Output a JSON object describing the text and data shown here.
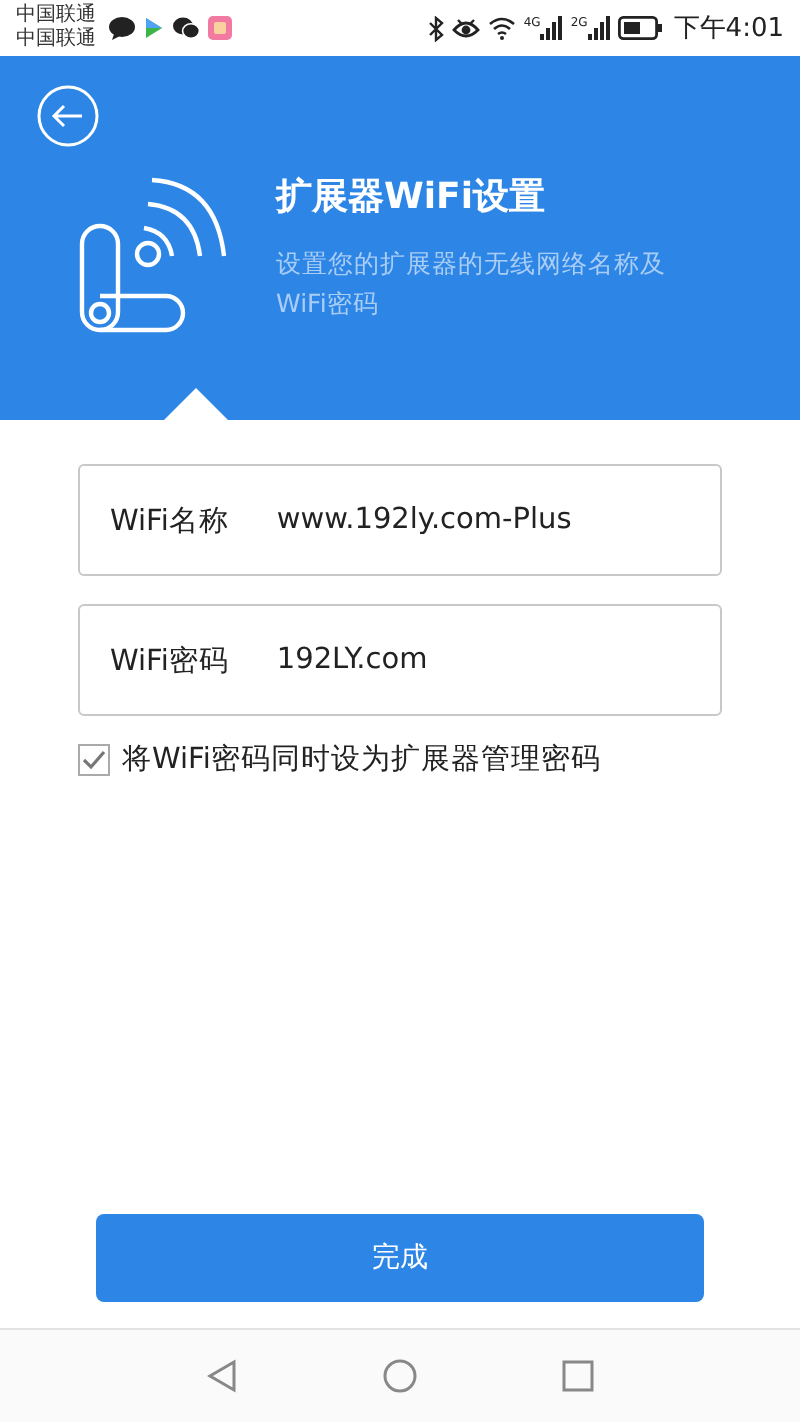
{
  "status_bar": {
    "carriers": [
      "中国联通",
      "中国联通"
    ],
    "signals": [
      "4G",
      "2G"
    ],
    "time": "下午4:01"
  },
  "header": {
    "title": "扩展器WiFi设置",
    "subtitle": "设置您的扩展器的无线网络名称及WiFi密码"
  },
  "fields": [
    {
      "label": "WiFi名称",
      "value": "www.192ly.com-Plus"
    },
    {
      "label": "WiFi密码",
      "value": "192LY.com"
    }
  ],
  "checkbox": {
    "label": "将WiFi密码同时设为扩展器管理密码",
    "checked": true
  },
  "button": {
    "label": "完成"
  }
}
